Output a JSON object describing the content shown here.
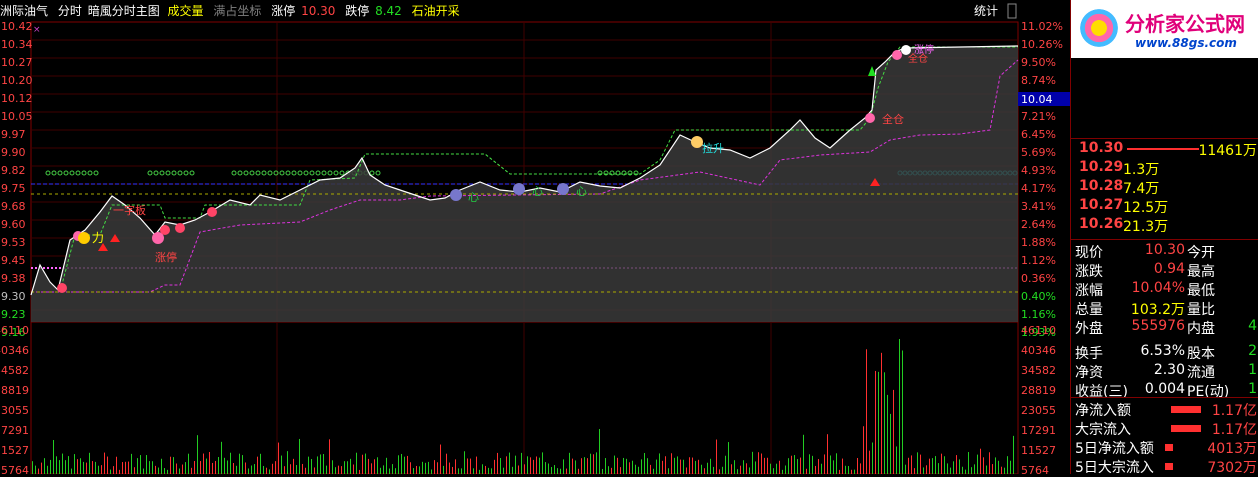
{
  "header": {
    "instrument": "洲际油气",
    "mode": "分时",
    "indicator": "暗風分时主图",
    "volume_label": "成交量",
    "fullscreen_label": "满占坐标",
    "limit_up_label": "涨停",
    "limit_up_value": "10.30",
    "limit_down_label": "跌停",
    "limit_down_value": "8.42",
    "sector": "石油开采",
    "stats_button": "统计"
  },
  "logo": {
    "title": "分析家公式网",
    "url": "www.88gs.com"
  },
  "axes": {
    "price_ticks": [
      "10.42",
      "10.34",
      "10.27",
      "10.20",
      "10.12",
      "10.05",
      "9.97",
      "9.90",
      "9.82",
      "9.75",
      "9.68",
      "9.60",
      "9.53",
      "9.45",
      "9.38",
      "9.30",
      "9.23",
      "9.16"
    ],
    "pct_ticks": [
      "11.02%",
      "10.26%",
      "9.50%",
      "8.74%",
      "7.97%",
      "7.21%",
      "6.45%",
      "5.69%",
      "4.93%",
      "4.17%",
      "3.41%",
      "2.64%",
      "1.88%",
      "1.12%",
      "0.36%",
      "0.40%",
      "1.16%",
      "1.93%"
    ],
    "volume_ticks_left": [
      "46110",
      "40346",
      "34582",
      "28819",
      "23055",
      "17291",
      "11527",
      "5764"
    ],
    "volume_ticks_right": [
      "46110",
      "40346",
      "34582",
      "28819",
      "23055",
      "17291",
      "11527",
      "5764"
    ],
    "current_price_tag": "10.04"
  },
  "annotations": {
    "li": "力",
    "yi_zi": "一字板",
    "zhang_ting": "涨停",
    "xi_xin_1": "心",
    "xi_xin_2": "心",
    "xi_xin_3": "心",
    "la_sheng": "拉升",
    "quan_cang_1": "全仓",
    "quan_cang_2": "全仓",
    "ting_label": "涨停"
  },
  "order_book": {
    "rows": [
      {
        "price": "10.30",
        "volume": "11461万"
      },
      {
        "price": "10.29",
        "volume": "1.3万"
      },
      {
        "price": "10.28",
        "volume": "7.4万"
      },
      {
        "price": "10.27",
        "volume": "12.5万"
      },
      {
        "price": "10.26",
        "volume": "21.3万"
      }
    ]
  },
  "quote": {
    "rows": [
      {
        "l1": "现价",
        "v1": "10.30",
        "l2": "今开",
        "v2": ""
      },
      {
        "l1": "涨跌",
        "v1": "0.94",
        "l2": "最高",
        "v2": ""
      },
      {
        "l1": "涨幅",
        "v1": "10.04%",
        "l2": "最低",
        "v2": ""
      },
      {
        "l1": "总量",
        "v1": "103.2万",
        "l2": "量比",
        "v2": ""
      },
      {
        "l1": "外盘",
        "v1": "555976",
        "l2": "内盘",
        "v2": "4"
      },
      {
        "l1": "换手",
        "v1": "6.53%",
        "l2": "股本",
        "v2": "2"
      },
      {
        "l1": "净资",
        "v1": "2.30",
        "l2": "流通",
        "v2": "1"
      },
      {
        "l1": "收益(三)",
        "v1": "0.004",
        "l2": "PE(动)",
        "v2": "1"
      }
    ]
  },
  "flows": [
    {
      "label": "净流入额",
      "value": "1.17亿"
    },
    {
      "label": "大宗流入",
      "value": "1.17亿"
    },
    {
      "label": "5日净流入额",
      "value": "4013万"
    },
    {
      "label": "5日大宗流入",
      "value": "7302万"
    }
  ],
  "colors": {
    "up": "#ff3030",
    "down": "#00cc00",
    "grid": "#800000",
    "price_line": "#ffffff",
    "dash_green": "#44dd44",
    "dash_magenta": "#dd33dd",
    "accent_yellow": "#ffff00"
  }
}
